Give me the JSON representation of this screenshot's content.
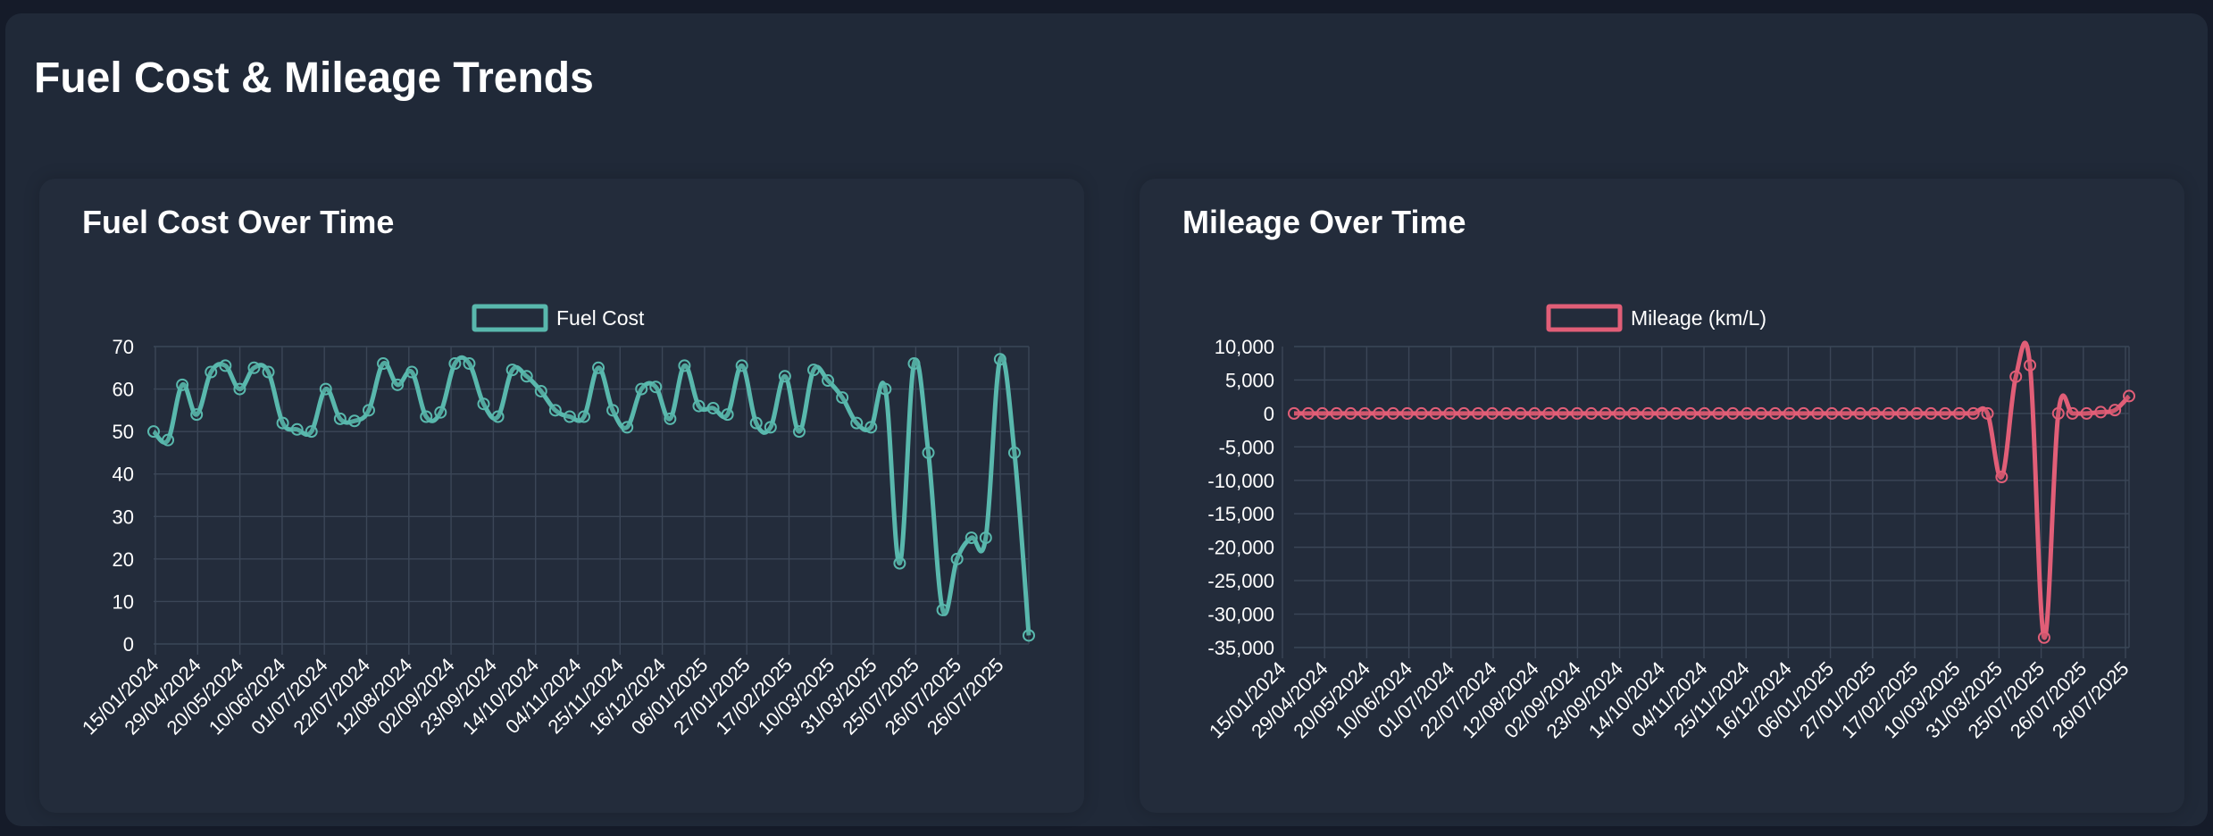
{
  "page": {
    "title": "Fuel Cost & Mileage Trends"
  },
  "colors": {
    "fuel": "#59b8ad",
    "mileage": "#e15e77",
    "grid": "#3b4657",
    "text": "#ffffff"
  },
  "chart_data": [
    {
      "type": "line",
      "title": "Fuel Cost Over Time",
      "series": [
        {
          "name": "Fuel Cost",
          "values": [
            50,
            48,
            61,
            54,
            64,
            65.5,
            60,
            65,
            64,
            52,
            50.5,
            50,
            60,
            53,
            52.5,
            55,
            66,
            61,
            64,
            53.5,
            54.5,
            66,
            66,
            56.5,
            53.5,
            64.5,
            63,
            59.5,
            55,
            53.5,
            53.5,
            65,
            55,
            51,
            60,
            60.5,
            53,
            65.5,
            56,
            55.5,
            54,
            65.5,
            52,
            51,
            63,
            50,
            64.5,
            62,
            58,
            52,
            51,
            60,
            19,
            66,
            45,
            8,
            20,
            25,
            25,
            67,
            45,
            2
          ]
        }
      ],
      "x_labels": [
        "15/01/2024",
        "29/04/2024",
        "20/05/2024",
        "10/06/2024",
        "01/07/2024",
        "22/07/2024",
        "12/08/2024",
        "02/09/2024",
        "23/09/2024",
        "14/10/2024",
        "04/11/2024",
        "25/11/2024",
        "16/12/2024",
        "06/01/2025",
        "27/01/2025",
        "17/02/2025",
        "10/03/2025",
        "31/03/2025",
        "25/07/2025",
        "26/07/2025",
        "26/07/2025"
      ],
      "y_ticks": [
        "70",
        "60",
        "50",
        "40",
        "30",
        "20",
        "10",
        "0"
      ],
      "ylim": [
        0,
        70
      ],
      "grid": true,
      "legend": "top-center"
    },
    {
      "type": "line",
      "title": "Mileage Over Time",
      "series": [
        {
          "name": "Mileage (km/L)",
          "values": [
            0,
            0,
            0,
            0,
            0,
            0,
            0,
            0,
            0,
            0,
            0,
            0,
            0,
            0,
            0,
            0,
            0,
            0,
            0,
            0,
            0,
            0,
            0,
            0,
            0,
            0,
            0,
            0,
            0,
            0,
            0,
            0,
            0,
            0,
            0,
            0,
            0,
            0,
            0,
            0,
            0,
            0,
            0,
            0,
            0,
            0,
            0,
            0,
            0,
            0,
            -9500,
            5500,
            7200,
            -33500,
            0,
            0,
            0,
            200,
            500,
            2600
          ]
        }
      ],
      "x_labels": [
        "15/01/2024",
        "29/04/2024",
        "20/05/2024",
        "10/06/2024",
        "01/07/2024",
        "22/07/2024",
        "12/08/2024",
        "02/09/2024",
        "23/09/2024",
        "14/10/2024",
        "04/11/2024",
        "25/11/2024",
        "16/12/2024",
        "06/01/2025",
        "27/01/2025",
        "17/02/2025",
        "10/03/2025",
        "31/03/2025",
        "25/07/2025",
        "26/07/2025",
        "26/07/2025"
      ],
      "y_ticks": [
        "10,000",
        "5,000",
        "0",
        "-5,000",
        "-10,000",
        "-15,000",
        "-20,000",
        "-25,000",
        "-30,000",
        "-35,000"
      ],
      "ylim": [
        -35000,
        10000
      ],
      "grid": true,
      "legend": "top-center"
    }
  ]
}
